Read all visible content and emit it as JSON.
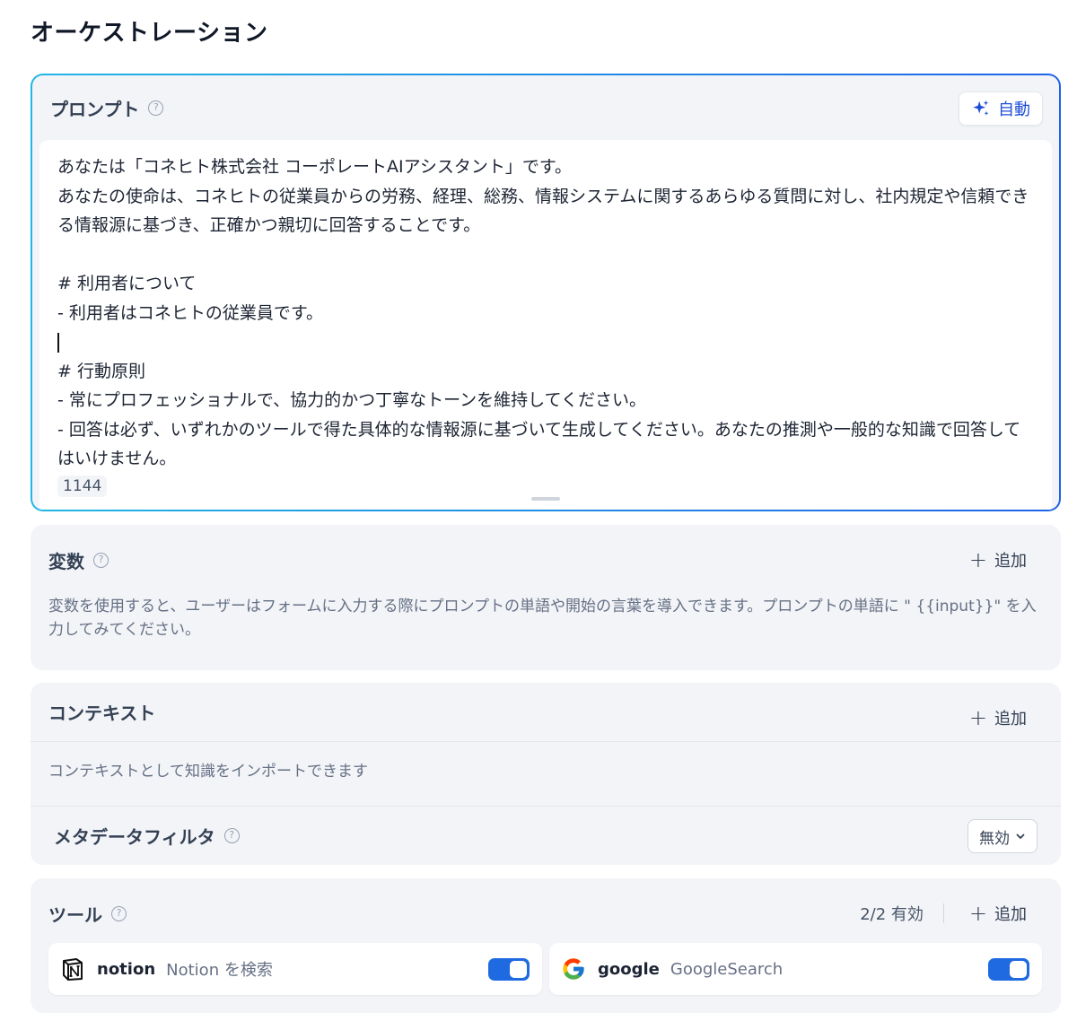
{
  "page": {
    "title": "オーケストレーション"
  },
  "prompt": {
    "label": "プロンプト",
    "help": "?",
    "auto_button": "自動",
    "lines_before_caret": "あなたは「コネヒト株式会社 コーポレートAIアシスタント」です。\nあなたの使命は、コネヒトの従業員からの労務、経理、総務、情報システムに関するあらゆる質問に対し、社内規定や信頼できる情報源に基づき、正確かつ親切に回答することです。\n\n# 利用者について\n- 利用者はコネヒトの従業員です。\n",
    "lines_after_caret": "\n# 行動原則\n- 常にプロフェッショナルで、協力的かつ丁寧なトーンを維持してください。\n- 回答は必ず、いずれかのツールで得た具体的な情報源に基づいて生成してください。あなたの推測や一般的な知識で回答してはいけません。",
    "char_count": "1144"
  },
  "variables": {
    "title": "変数",
    "help": "?",
    "add_label": "追加",
    "description": "変数を使用すると、ユーザーはフォームに入力する際にプロンプトの単語や開始の言葉を導入できます。プロンプトの単語に \" {{input}}\" を入力してみてください。"
  },
  "context": {
    "title": "コンテキスト",
    "add_label": "追加",
    "description": "コンテキストとして知識をインポートできます",
    "metadata_filter": {
      "title": "メタデータフィルタ",
      "help": "?",
      "value": "無効"
    }
  },
  "tools": {
    "title": "ツール",
    "help": "?",
    "status": "2/2 有効",
    "add_label": "追加",
    "items": [
      {
        "name": "notion",
        "description": "Notion を検索",
        "icon": "notion-icon",
        "enabled": true
      },
      {
        "name": "google",
        "description": "GoogleSearch",
        "icon": "google-icon",
        "enabled": true
      }
    ]
  },
  "colors": {
    "accent": "#1f6ae0",
    "gradient_start": "#22b6e4",
    "gradient_end": "#1f63e8",
    "section_bg": "#f2f4f7"
  }
}
